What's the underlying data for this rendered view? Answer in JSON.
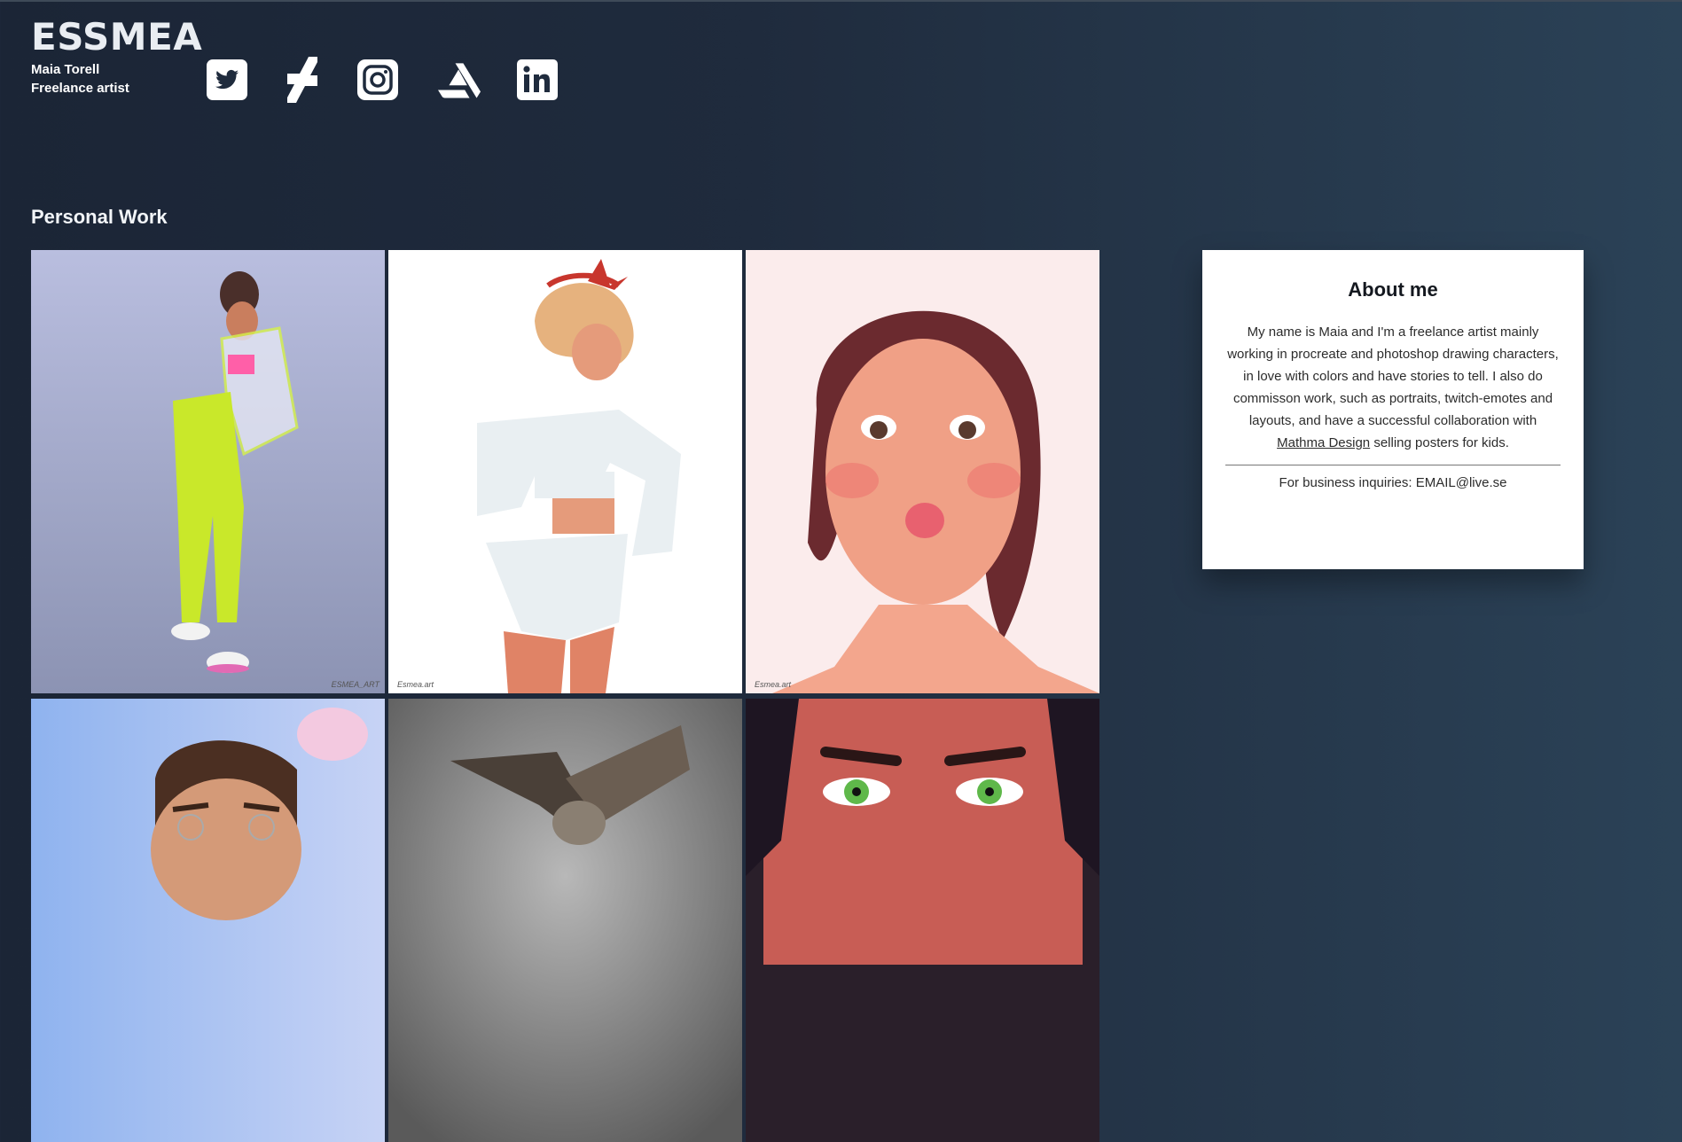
{
  "header": {
    "logo": "ESSMEA",
    "name": "Maia Torell",
    "role": "Freelance artist"
  },
  "social": [
    {
      "icon": "twitter-icon"
    },
    {
      "icon": "deviantart-icon"
    },
    {
      "icon": "instagram-icon"
    },
    {
      "icon": "artstation-icon"
    },
    {
      "icon": "linkedin-icon"
    }
  ],
  "section": {
    "title": "Personal Work"
  },
  "gallery": {
    "watermarks": [
      "ESMEA_ART",
      "Esmea.art",
      "Esmea.art"
    ]
  },
  "about": {
    "title": "About me",
    "text_before": "My name is Maia and I'm a freelance artist mainly working in procreate and photoshop drawing characters, in love with colors and have stories to tell. I also do commisson work, such as portraits, twitch-emotes and layouts, and have a successful collaboration with ",
    "link": "Mathma Design",
    "text_after": " selling posters for kids.",
    "business": "For business inquiries: EMAIL@live.se"
  }
}
